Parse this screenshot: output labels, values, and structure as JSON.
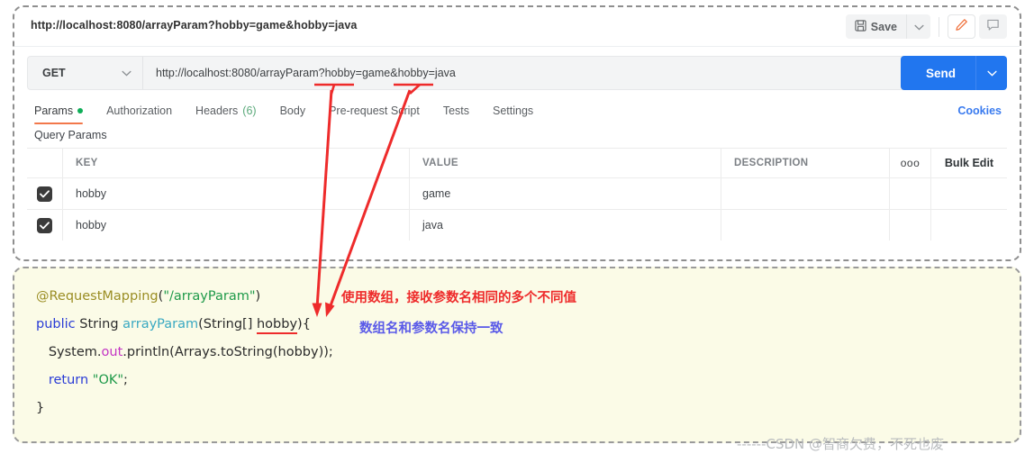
{
  "titlebar": {
    "tab_url": "http://localhost:8080/arrayParam?hobby=game&hobby=java",
    "save_label": "Save",
    "save_icon": "floppy-disk-icon",
    "save_caret_icon": "chevron-down-icon",
    "edit_icon": "pencil-icon",
    "comment_icon": "comment-icon"
  },
  "request": {
    "method": "GET",
    "method_caret_icon": "chevron-down-icon",
    "url": "http://localhost:8080/arrayParam?hobby=game&hobby=java",
    "send_label": "Send",
    "send_caret_icon": "chevron-down-icon"
  },
  "tabs": [
    {
      "label": "Params",
      "active": true,
      "dot": true
    },
    {
      "label": "Authorization",
      "active": false
    },
    {
      "label": "Headers",
      "count": "(6)",
      "active": false
    },
    {
      "label": "Body",
      "active": false
    },
    {
      "label": "Pre-request Script",
      "active": false
    },
    {
      "label": "Tests",
      "active": false
    },
    {
      "label": "Settings",
      "active": false
    }
  ],
  "cookies_link": "Cookies",
  "query_params_label": "Query Params",
  "params_table": {
    "headers": {
      "key": "KEY",
      "value": "VALUE",
      "description": "DESCRIPTION",
      "more_icon": "ooo",
      "bulk_edit": "Bulk Edit"
    },
    "rows": [
      {
        "checked": true,
        "key": "hobby",
        "value": "game",
        "description": ""
      },
      {
        "checked": true,
        "key": "hobby",
        "value": "java",
        "description": ""
      }
    ]
  },
  "code": {
    "lines": [
      [
        {
          "t": "@RequestMapping",
          "c": "c-anno"
        },
        {
          "t": "(",
          "c": "c-plain"
        },
        {
          "t": "\"/arrayParam\"",
          "c": "c-str"
        },
        {
          "t": ")",
          "c": "c-plain"
        }
      ],
      [
        {
          "t": "public",
          "c": "c-kw"
        },
        {
          "t": " ",
          "c": "c-plain"
        },
        {
          "t": "String",
          "c": "c-type"
        },
        {
          "t": " ",
          "c": "c-plain"
        },
        {
          "t": "arrayParam",
          "c": "c-method"
        },
        {
          "t": "(String[] ",
          "c": "c-plain"
        },
        {
          "t": "hobby",
          "c": "c-plain c-under"
        },
        {
          "t": "){",
          "c": "c-plain"
        }
      ],
      [
        {
          "t": "   System.",
          "c": "c-plain"
        },
        {
          "t": "out",
          "c": "c-field"
        },
        {
          "t": ".println(Arrays.toString(hobby));",
          "c": "c-plain"
        }
      ],
      [
        {
          "t": "   ",
          "c": "c-plain"
        },
        {
          "t": "return",
          "c": "c-kw"
        },
        {
          "t": " ",
          "c": "c-plain"
        },
        {
          "t": "\"OK\"",
          "c": "c-str"
        },
        {
          "t": ";",
          "c": "c-plain"
        }
      ],
      [
        {
          "t": "}",
          "c": "c-plain"
        }
      ]
    ]
  },
  "annotations": {
    "red_note": "使用数组，接收参数名相同的多个不同值",
    "blue_note": "数组名和参数名保持一致",
    "arrow_color": "#ee2b2b",
    "underline_color": "#ee2b2b"
  },
  "watermark": "------CSDN @智商欠费，不死也废"
}
